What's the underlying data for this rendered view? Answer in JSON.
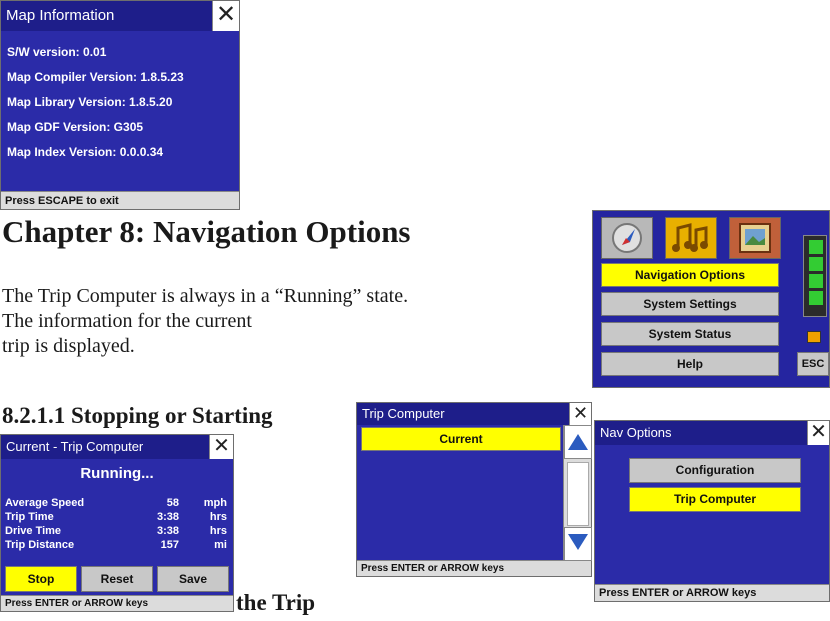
{
  "map_info": {
    "title": "Map Information",
    "lines": [
      "S/W version: 0.01",
      "Map Compiler Version: 1.8.5.23",
      "Map Library Version: 1.8.5.20",
      "Map GDF Version: G305",
      "Map Index Version: 0.0.0.34"
    ],
    "status": "Press ESCAPE to exit"
  },
  "doc": {
    "chapter_heading": "Chapter 8: Navigation Options",
    "paragraph_lines": [
      "The Trip Computer is always in a “Running” state.",
      "The information for the current",
      "trip is displayed."
    ],
    "section_heading": "8.2.1.1 Stopping or Starting",
    "trailing_text": "the Trip"
  },
  "main_menu": {
    "buttons": [
      "Navigation Options",
      "System Settings",
      "System Status",
      "Help"
    ],
    "esc_label": "ESC"
  },
  "current_trip": {
    "title": "Current - Trip Computer",
    "state": "Running...",
    "rows": [
      {
        "label": "Average Speed",
        "value": "58",
        "unit": "mph"
      },
      {
        "label": "Trip Time",
        "value": "3:38",
        "unit": "hrs"
      },
      {
        "label": "Drive Time",
        "value": "3:38",
        "unit": "hrs"
      },
      {
        "label": "Trip Distance",
        "value": "157",
        "unit": "mi"
      }
    ],
    "buttons": {
      "stop": "Stop",
      "reset": "Reset",
      "save": "Save"
    },
    "status": "Press ENTER or ARROW keys"
  },
  "trip_list": {
    "title": "Trip Computer",
    "selected_item": "Current",
    "status": "Press ENTER or ARROW keys"
  },
  "nav_options": {
    "title": "Nav Options",
    "items": [
      "Configuration",
      "Trip Computer"
    ],
    "status": "Press ENTER or ARROW keys"
  },
  "colors": {
    "panel_blue": "#2b2ba8",
    "title_blue": "#1e1e8a",
    "highlight_yellow": "#ffff00",
    "button_gray": "#c8c8c8",
    "battery_green": "#33cc33"
  }
}
